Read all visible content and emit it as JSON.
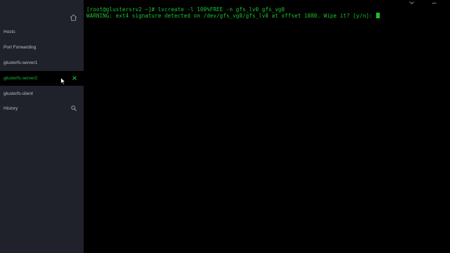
{
  "sidebar": {
    "items": [
      {
        "label": "Hosts"
      },
      {
        "label": "Port Forwarding"
      },
      {
        "label": "glusterfs-server1"
      },
      {
        "label": "glusterfs-server2"
      },
      {
        "label": "glusterfs-client"
      },
      {
        "label": "History"
      }
    ],
    "active_index": 3
  },
  "terminal": {
    "lines": [
      "[root@glustersrv2 ~]# lvcreate -l 100%FREE -n gfs_lv0 gfs_vg0",
      "WARNING: ext4 signature detected on /dev/gfs_vg0/gfs_lv0 at offset 1080. Wipe it? [y/n]: "
    ]
  },
  "colors": {
    "sidebar_bg": "#1f222b",
    "accent_green": "#1fb83a",
    "terminal_text": "#1ec22f",
    "terminal_bg": "#000000"
  },
  "icons": [
    "home-icon",
    "close-icon",
    "search-icon",
    "chevron-down-icon",
    "minimize-icon"
  ]
}
